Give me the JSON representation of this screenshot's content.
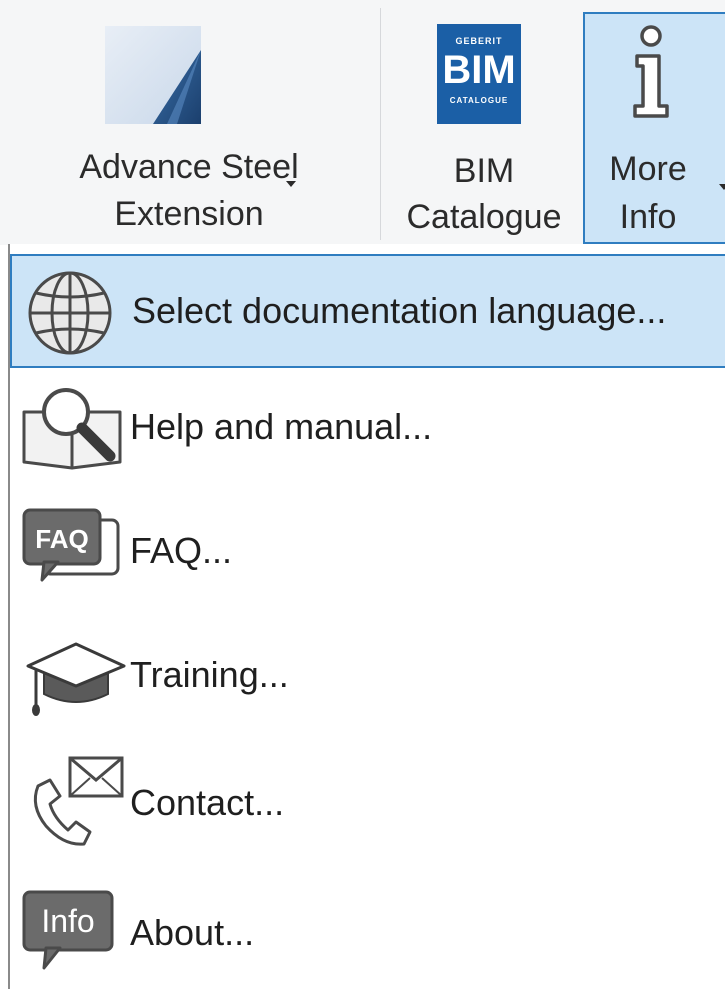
{
  "ribbon": {
    "advance_steel": {
      "line1": "Advance Steel",
      "line2": "Extension",
      "icon": "advance-steel-icon",
      "has_dropdown": true
    },
    "bim_catalogue": {
      "line1": "BIM",
      "line2": "Catalogue",
      "icon": "geberit-bim-catalogue-icon",
      "logo_top": "GEBERIT",
      "logo_main": "BIM",
      "logo_bottom": "CATALOGUE"
    },
    "more_info": {
      "line1": "More",
      "line2": "Info",
      "icon": "info-i-icon",
      "state": "pressed",
      "has_dropdown": true
    }
  },
  "menu": {
    "items": [
      {
        "label": "Select documentation language...",
        "icon": "globe-icon",
        "highlighted": true
      },
      {
        "label": "Help and manual...",
        "icon": "book-magnifier-icon",
        "highlighted": false
      },
      {
        "label": "FAQ...",
        "icon": "faq-speech-bubble-icon",
        "highlighted": false
      },
      {
        "label": "Training...",
        "icon": "graduation-cap-icon",
        "highlighted": false
      },
      {
        "label": "Contact...",
        "icon": "phone-envelope-icon",
        "highlighted": false
      },
      {
        "label": "About...",
        "icon": "info-bubble-icon",
        "highlighted": false
      }
    ]
  },
  "colors": {
    "ribbon_bg": "#f5f6f7",
    "pressed_bg": "#cce4f7",
    "pressed_border": "#2f7dc0",
    "bim_blue": "#1b5fa6",
    "icon_gray": "#5a5a5a"
  }
}
